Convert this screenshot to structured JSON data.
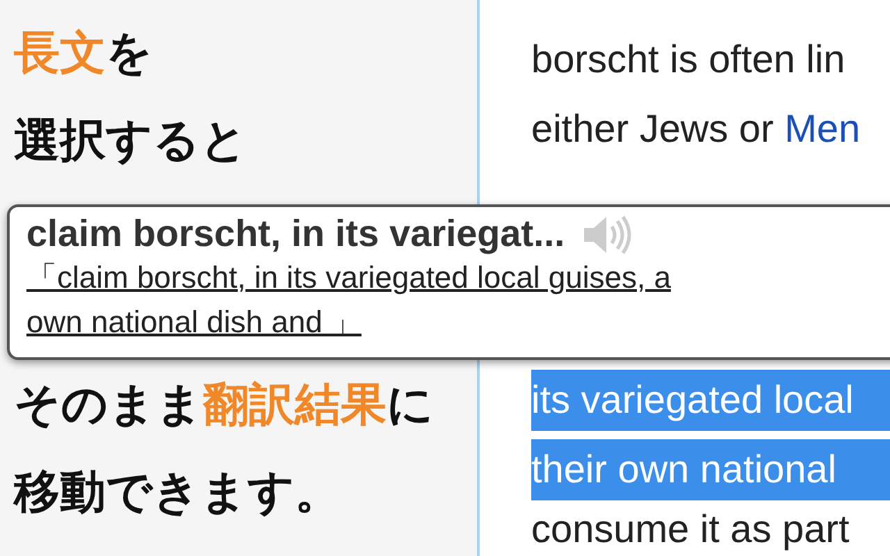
{
  "caption_lines": [
    {
      "parts": [
        {
          "text": "長文",
          "accent": true
        },
        {
          "text": "を",
          "accent": false
        }
      ]
    },
    {
      "parts": [
        {
          "text": "選択すると",
          "accent": false
        }
      ]
    },
    {
      "parts": [
        {
          "text": "そのまま",
          "accent": false
        },
        {
          "text": "翻訳結果",
          "accent": true
        },
        {
          "text": "に",
          "accent": false
        }
      ]
    },
    {
      "parts": [
        {
          "text": "移動できます。",
          "accent": false
        }
      ]
    }
  ],
  "article_lines": [
    {
      "text": "borscht is often lin",
      "selected": false
    },
    {
      "text": "either Jews or ",
      "link": "Men",
      "selected": false
    },
    {
      "text": "its variegated local",
      "selected": true
    },
    {
      "text": "their own national",
      "selected": true
    },
    {
      "text": "consume it as part",
      "selected": false
    }
  ],
  "popup": {
    "title": "claim borscht, in its variegat...",
    "body_lines": [
      "「claim borscht, in its variegated local guises, a",
      "own national dish and 」"
    ]
  }
}
